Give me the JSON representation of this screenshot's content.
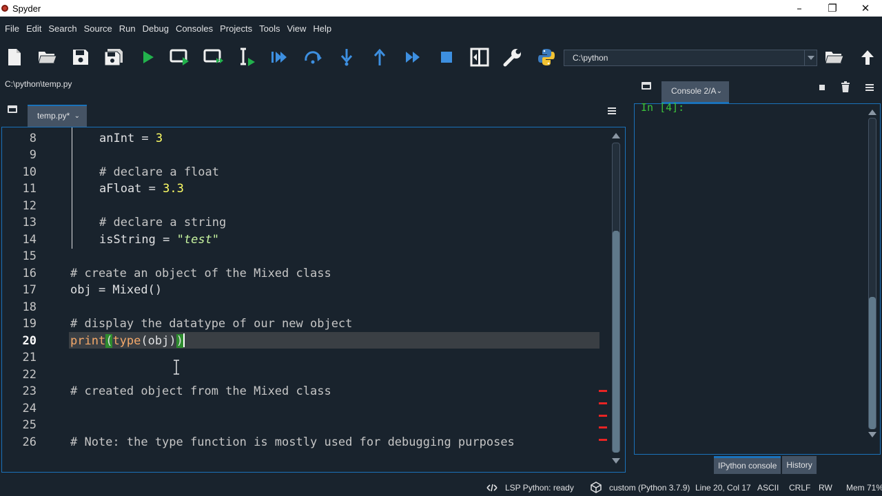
{
  "window": {
    "title": "Spyder",
    "minimize": "–",
    "maximize": "❐",
    "close": "✕"
  },
  "menu": [
    "File",
    "Edit",
    "Search",
    "Source",
    "Run",
    "Debug",
    "Consoles",
    "Projects",
    "Tools",
    "View",
    "Help"
  ],
  "toolbar": {
    "working_directory": "C:\\python"
  },
  "editor": {
    "file_path": "C:\\python\\temp.py",
    "tab_label": "temp.py*",
    "tab_close": "⌄",
    "current_line": 20,
    "lines": [
      {
        "num": "8"
      },
      {
        "num": "9"
      },
      {
        "num": "10"
      },
      {
        "num": "11"
      },
      {
        "num": "12"
      },
      {
        "num": "13"
      },
      {
        "num": "14"
      },
      {
        "num": "15"
      },
      {
        "num": "16"
      },
      {
        "num": "17"
      },
      {
        "num": "18"
      },
      {
        "num": "19"
      },
      {
        "num": "20"
      },
      {
        "num": "21"
      },
      {
        "num": "22"
      },
      {
        "num": "23"
      },
      {
        "num": "24"
      },
      {
        "num": "25"
      },
      {
        "num": "26"
      }
    ],
    "code": {
      "l8_var": "anInt",
      "l8_op": " = ",
      "l8_num": "3",
      "l10": "# declare a float",
      "l11_var": "aFloat",
      "l11_op": " = ",
      "l11_num": "3.3",
      "l13": "# declare a string",
      "l14_var": "isString",
      "l14_op": " = ",
      "l14_str": "\"test\"",
      "l16": "# create an object of the Mixed class",
      "l17": "obj = Mixed()",
      "l19": "# display the datatype of our new object",
      "l20_print": "print",
      "l20_open": "(",
      "l20_type": "type",
      "l20_inner": "(obj)",
      "l20_close": ")",
      "l23": "# created object from the Mixed class",
      "l26": "# Note: the type function is mostly used for debugging purposes"
    }
  },
  "console": {
    "tab_label": "Console 2/A",
    "tab_close": "⌄",
    "prompt_text": "In [4]:",
    "bottom_tabs": [
      "IPython console",
      "History"
    ]
  },
  "status": {
    "lsp": "LSP Python: ready",
    "env": "custom (Python 3.7.9)",
    "position": "Line 20, Col 17",
    "encoding": "ASCII",
    "eol": "CRLF",
    "mode": "RW",
    "memory": "Mem 71%"
  }
}
